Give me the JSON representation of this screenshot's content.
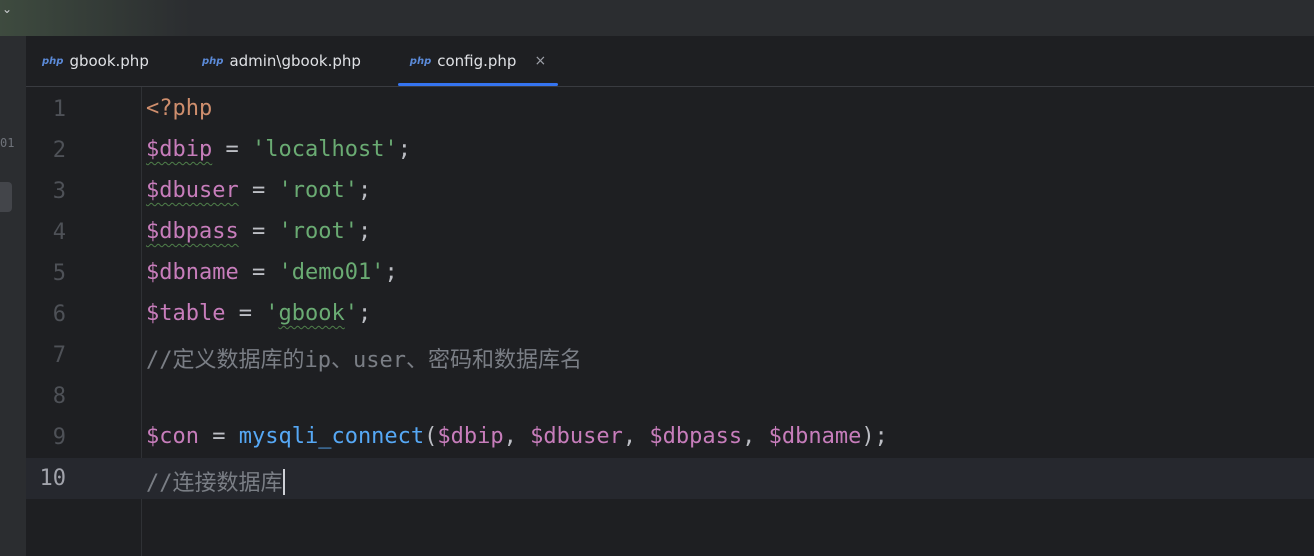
{
  "window": {
    "collapse_glyph": "⌄"
  },
  "left_strip": {
    "partial_number": "01"
  },
  "tabs": [
    {
      "icon": "php",
      "label": "gbook.php",
      "active": false
    },
    {
      "icon": "php",
      "label": "admin\\gbook.php",
      "active": false
    },
    {
      "icon": "php",
      "label": "config.php",
      "active": true,
      "close": "×"
    }
  ],
  "editor": {
    "current_line": 10,
    "lines": [
      {
        "n": "1",
        "tokens": [
          {
            "t": "<?php",
            "c": "kw"
          }
        ]
      },
      {
        "n": "2",
        "tokens": [
          {
            "t": "$dbip",
            "c": "var",
            "w": true
          },
          {
            "t": " = ",
            "c": "op"
          },
          {
            "t": "'localhost'",
            "c": "str"
          },
          {
            "t": ";",
            "c": "op"
          }
        ]
      },
      {
        "n": "3",
        "tokens": [
          {
            "t": "$dbuser",
            "c": "var",
            "w": true
          },
          {
            "t": " = ",
            "c": "op"
          },
          {
            "t": "'root'",
            "c": "str"
          },
          {
            "t": ";",
            "c": "op"
          }
        ]
      },
      {
        "n": "4",
        "tokens": [
          {
            "t": "$dbpass",
            "c": "var",
            "w": true
          },
          {
            "t": " = ",
            "c": "op"
          },
          {
            "t": "'root'",
            "c": "str"
          },
          {
            "t": ";",
            "c": "op"
          }
        ]
      },
      {
        "n": "5",
        "tokens": [
          {
            "t": "$dbname",
            "c": "var"
          },
          {
            "t": " = ",
            "c": "op"
          },
          {
            "t": "'demo01'",
            "c": "str"
          },
          {
            "t": ";",
            "c": "op"
          }
        ]
      },
      {
        "n": "6",
        "tokens": [
          {
            "t": "$table",
            "c": "var"
          },
          {
            "t": " = ",
            "c": "op"
          },
          {
            "t": "'",
            "c": "str"
          },
          {
            "t": "gbook",
            "c": "str",
            "w": true
          },
          {
            "t": "'",
            "c": "str"
          },
          {
            "t": ";",
            "c": "op"
          }
        ]
      },
      {
        "n": "7",
        "tokens": [
          {
            "t": "//定义数据库的ip、user、密码和数据库名",
            "c": "cm"
          }
        ]
      },
      {
        "n": "8",
        "tokens": []
      },
      {
        "n": "9",
        "tokens": [
          {
            "t": "$con",
            "c": "var"
          },
          {
            "t": " = ",
            "c": "op"
          },
          {
            "t": "mysqli_connect",
            "c": "fn"
          },
          {
            "t": "(",
            "c": "op"
          },
          {
            "t": "$dbip",
            "c": "var"
          },
          {
            "t": ", ",
            "c": "op"
          },
          {
            "t": "$dbuser",
            "c": "var"
          },
          {
            "t": ", ",
            "c": "op"
          },
          {
            "t": "$dbpass",
            "c": "var"
          },
          {
            "t": ", ",
            "c": "op"
          },
          {
            "t": "$dbname",
            "c": "var"
          },
          {
            "t": ");",
            "c": "op"
          }
        ]
      },
      {
        "n": "10",
        "tokens": [
          {
            "t": "//连接数据库",
            "c": "cm"
          }
        ]
      }
    ]
  },
  "colors": {
    "background": "#1e1f22",
    "keyword": "#cf8e6d",
    "variable": "#c77dbb",
    "string": "#6aab73",
    "function": "#56a8f5",
    "comment": "#7a7e85",
    "tab_underline": "#3574f0"
  }
}
